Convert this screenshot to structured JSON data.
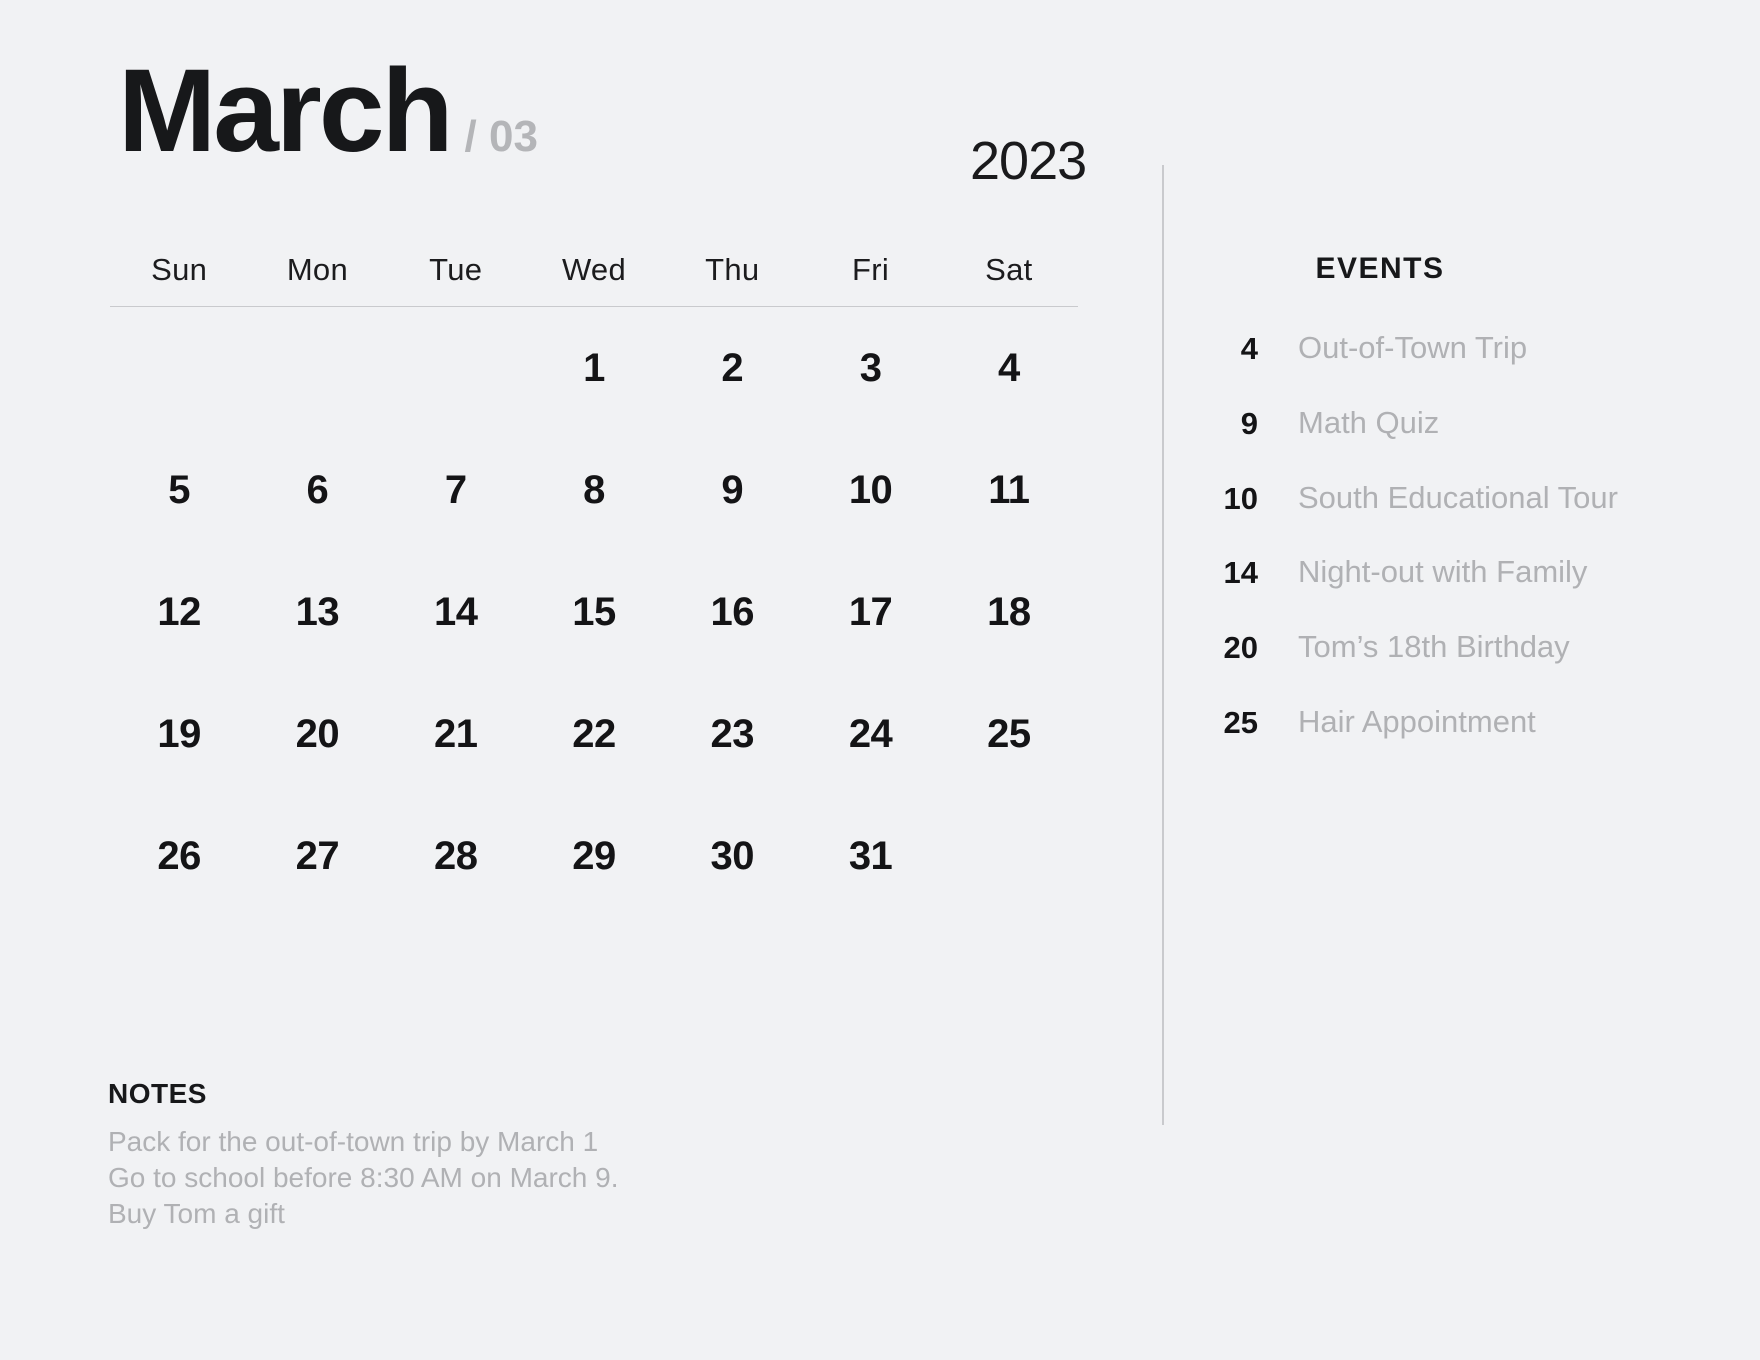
{
  "header": {
    "month_name": "March",
    "month_number": "/ 03",
    "year": "2023"
  },
  "calendar": {
    "weekdays": [
      "Sun",
      "Mon",
      "Tue",
      "Wed",
      "Thu",
      "Fri",
      "Sat"
    ],
    "weeks": [
      [
        "",
        "",
        "",
        "1",
        "2",
        "3",
        "4"
      ],
      [
        "5",
        "6",
        "7",
        "8",
        "9",
        "10",
        "11"
      ],
      [
        "12",
        "13",
        "14",
        "15",
        "16",
        "17",
        "18"
      ],
      [
        "19",
        "20",
        "21",
        "22",
        "23",
        "24",
        "25"
      ],
      [
        "26",
        "27",
        "28",
        "29",
        "30",
        "31",
        ""
      ]
    ]
  },
  "notes": {
    "title": "NOTES",
    "lines": [
      "Pack for the out-of-town trip by March 1",
      "Go to school before 8:30 AM on March 9.",
      "Buy Tom a gift"
    ]
  },
  "events": {
    "title": "EVENTS",
    "items": [
      {
        "date": "4",
        "label": "Out-of-Town Trip"
      },
      {
        "date": "9",
        "label": "Math Quiz"
      },
      {
        "date": "10",
        "label": "South Educational Tour"
      },
      {
        "date": "14",
        "label": "Night-out with Family"
      },
      {
        "date": "20",
        "label": "Tom’s 18th Birthday"
      },
      {
        "date": "25",
        "label": "Hair Appointment"
      }
    ]
  },
  "colors": {
    "background": "#f1f2f4",
    "text_dark": "#17181a",
    "text_muted": "#b0b1b4",
    "divider": "#c9cacd"
  }
}
